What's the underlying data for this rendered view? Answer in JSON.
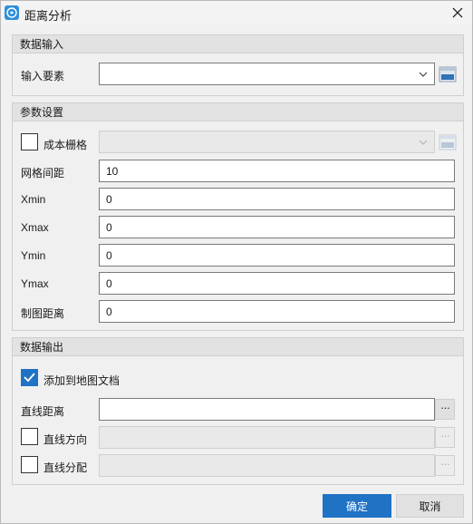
{
  "window": {
    "title": "距离分析",
    "icon": "app-logo-icon"
  },
  "input_section": {
    "header": "数据输入",
    "feature_label": "输入要素",
    "feature_value": ""
  },
  "params_section": {
    "header": "参数设置",
    "cost_raster": {
      "label": "成本栅格",
      "checked": false,
      "value": ""
    },
    "fields": [
      {
        "label": "网格间距",
        "value": "10"
      },
      {
        "label": "Xmin",
        "value": "0"
      },
      {
        "label": "Xmax",
        "value": "0"
      },
      {
        "label": "Ymin",
        "value": "0"
      },
      {
        "label": "Ymax",
        "value": "0"
      },
      {
        "label": "制图距离",
        "value": "0"
      }
    ]
  },
  "output_section": {
    "header": "数据输出",
    "add_to_map": {
      "label": "添加到地图文档",
      "checked": true
    },
    "straight_distance": {
      "label": "直线距离",
      "value": ""
    },
    "straight_direction": {
      "label": "直线方向",
      "checked": false,
      "value": ""
    },
    "straight_allocation": {
      "label": "直线分配",
      "checked": false,
      "value": ""
    },
    "browse_label": "···"
  },
  "buttons": {
    "ok": "确定",
    "cancel": "取消"
  },
  "colors": {
    "accent": "#1f72c4",
    "header_bg": "#e2e2e2",
    "window_bg": "#f0f0f0"
  }
}
